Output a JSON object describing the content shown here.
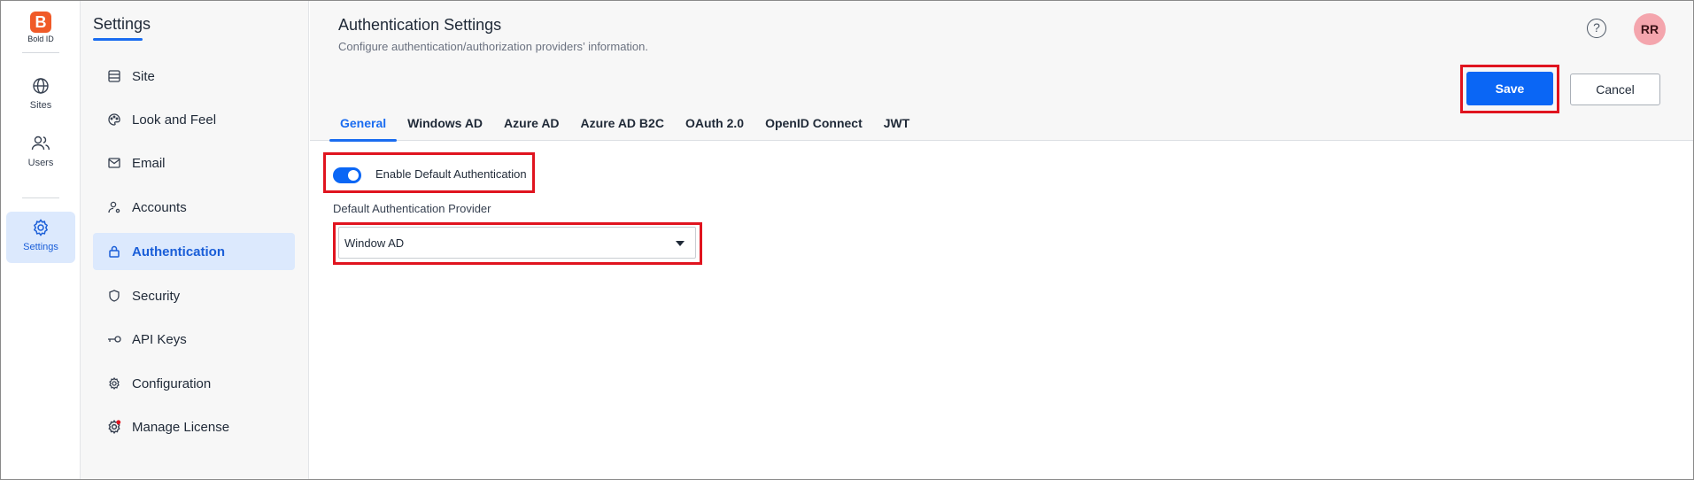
{
  "brand": {
    "logo_glyph": "B",
    "name": "Bold ID",
    "color": "#f05a28"
  },
  "rail": {
    "items": [
      {
        "label": "Sites",
        "icon": "globe-icon"
      },
      {
        "label": "Users",
        "icon": "users-icon"
      },
      {
        "label": "Settings",
        "icon": "gear-icon",
        "active": true
      }
    ]
  },
  "settings_nav": {
    "title": "Settings",
    "items": [
      {
        "label": "Site",
        "icon": "site-icon"
      },
      {
        "label": "Look and Feel",
        "icon": "palette-icon"
      },
      {
        "label": "Email",
        "icon": "mail-icon"
      },
      {
        "label": "Accounts",
        "icon": "account-icon"
      },
      {
        "label": "Authentication",
        "icon": "lock-icon",
        "active": true
      },
      {
        "label": "Security",
        "icon": "shield-icon"
      },
      {
        "label": "API Keys",
        "icon": "key-icon"
      },
      {
        "label": "Configuration",
        "icon": "gear-icon"
      },
      {
        "label": "Manage License",
        "icon": "license-gear-icon",
        "badge_color": "#e0141f"
      }
    ]
  },
  "header": {
    "title": "Authentication Settings",
    "subtitle": "Configure authentication/authorization providers’ information.",
    "help_glyph": "?",
    "avatar_initials": "RR"
  },
  "actions": {
    "save_label": "Save",
    "cancel_label": "Cancel"
  },
  "tabs": [
    {
      "label": "General",
      "active": true
    },
    {
      "label": "Windows AD"
    },
    {
      "label": "Azure AD"
    },
    {
      "label": "Azure AD B2C"
    },
    {
      "label": "OAuth 2.0"
    },
    {
      "label": "OpenID Connect"
    },
    {
      "label": "JWT"
    }
  ],
  "general": {
    "enable_default_auth_label": "Enable Default Authentication",
    "enable_default_auth_on": true,
    "provider_label": "Default Authentication Provider",
    "provider_value": "Window AD"
  },
  "colors": {
    "accent": "#0a66f5",
    "highlight": "#e0141f",
    "avatar_bg": "#f4a5ad"
  }
}
